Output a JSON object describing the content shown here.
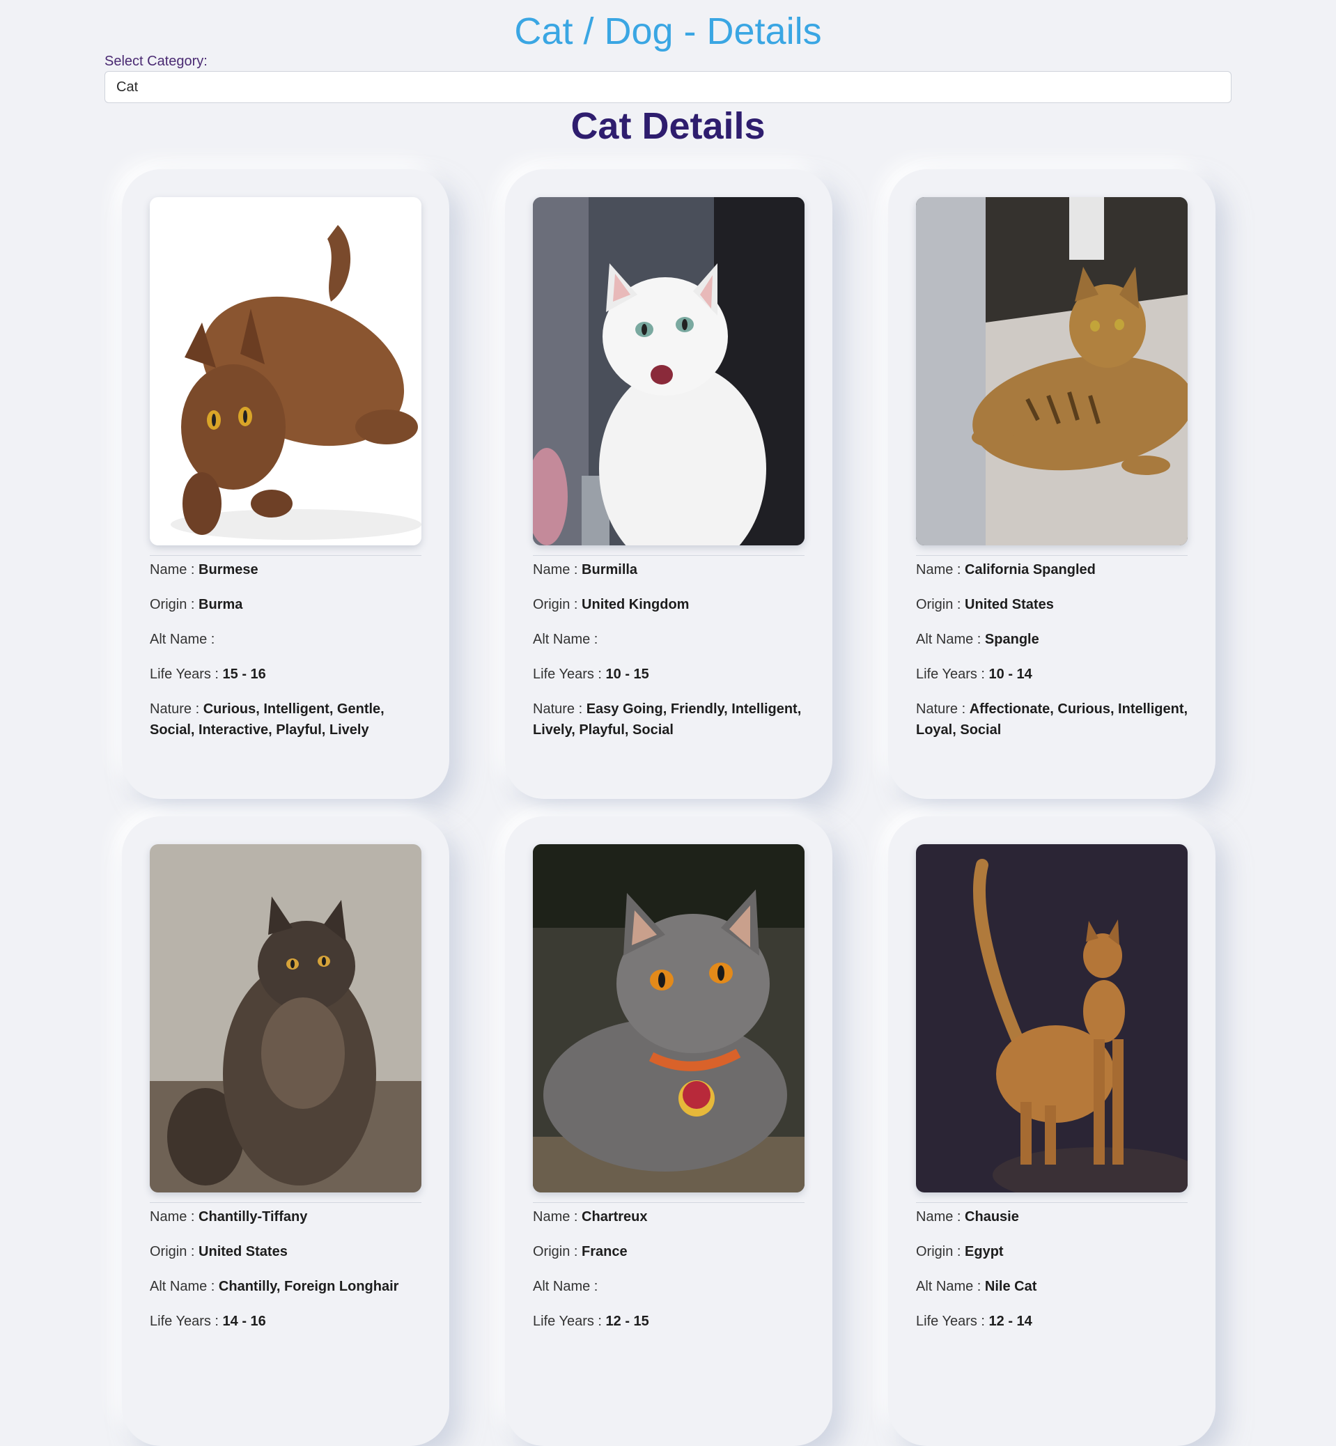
{
  "header": {
    "title": "Cat / Dog - Details"
  },
  "category": {
    "label": "Select Category:",
    "selected": "Cat"
  },
  "section": {
    "title": "Cat Details"
  },
  "field_labels": {
    "name": "Name : ",
    "origin": "Origin : ",
    "alt_name": "Alt Name : ",
    "life_years": "Life Years : ",
    "nature": "Nature : "
  },
  "cards": [
    {
      "name": "Burmese",
      "origin": "Burma",
      "alt_name": "",
      "life_years": "15 - 16",
      "nature": "Curious, Intelligent, Gentle, Social, Interactive, Playful, Lively",
      "photo_icon": "cat-photo"
    },
    {
      "name": "Burmilla",
      "origin": "United Kingdom",
      "alt_name": "",
      "life_years": "10 - 15",
      "nature": "Easy Going, Friendly, Intelligent, Lively, Playful, Social",
      "photo_icon": "cat-photo"
    },
    {
      "name": "California Spangled",
      "origin": "United States",
      "alt_name": "Spangle",
      "life_years": "10 - 14",
      "nature": "Affectionate, Curious, Intelligent, Loyal, Social",
      "photo_icon": "cat-photo"
    },
    {
      "name": "Chantilly-Tiffany",
      "origin": "United States",
      "alt_name": "Chantilly, Foreign Longhair",
      "life_years": "14 - 16",
      "nature": "",
      "photo_icon": "cat-photo"
    },
    {
      "name": "Chartreux",
      "origin": "France",
      "alt_name": "",
      "life_years": "12 - 15",
      "nature": "",
      "photo_icon": "cat-photo"
    },
    {
      "name": "Chausie",
      "origin": "Egypt",
      "alt_name": "Nile Cat",
      "life_years": "12 - 14",
      "nature": "",
      "photo_icon": "cat-photo"
    }
  ],
  "colors": {
    "background": "#f1f2f6",
    "title": "#3aa6e3",
    "section_title": "#2e1d6e",
    "label": "#4a2a72"
  }
}
